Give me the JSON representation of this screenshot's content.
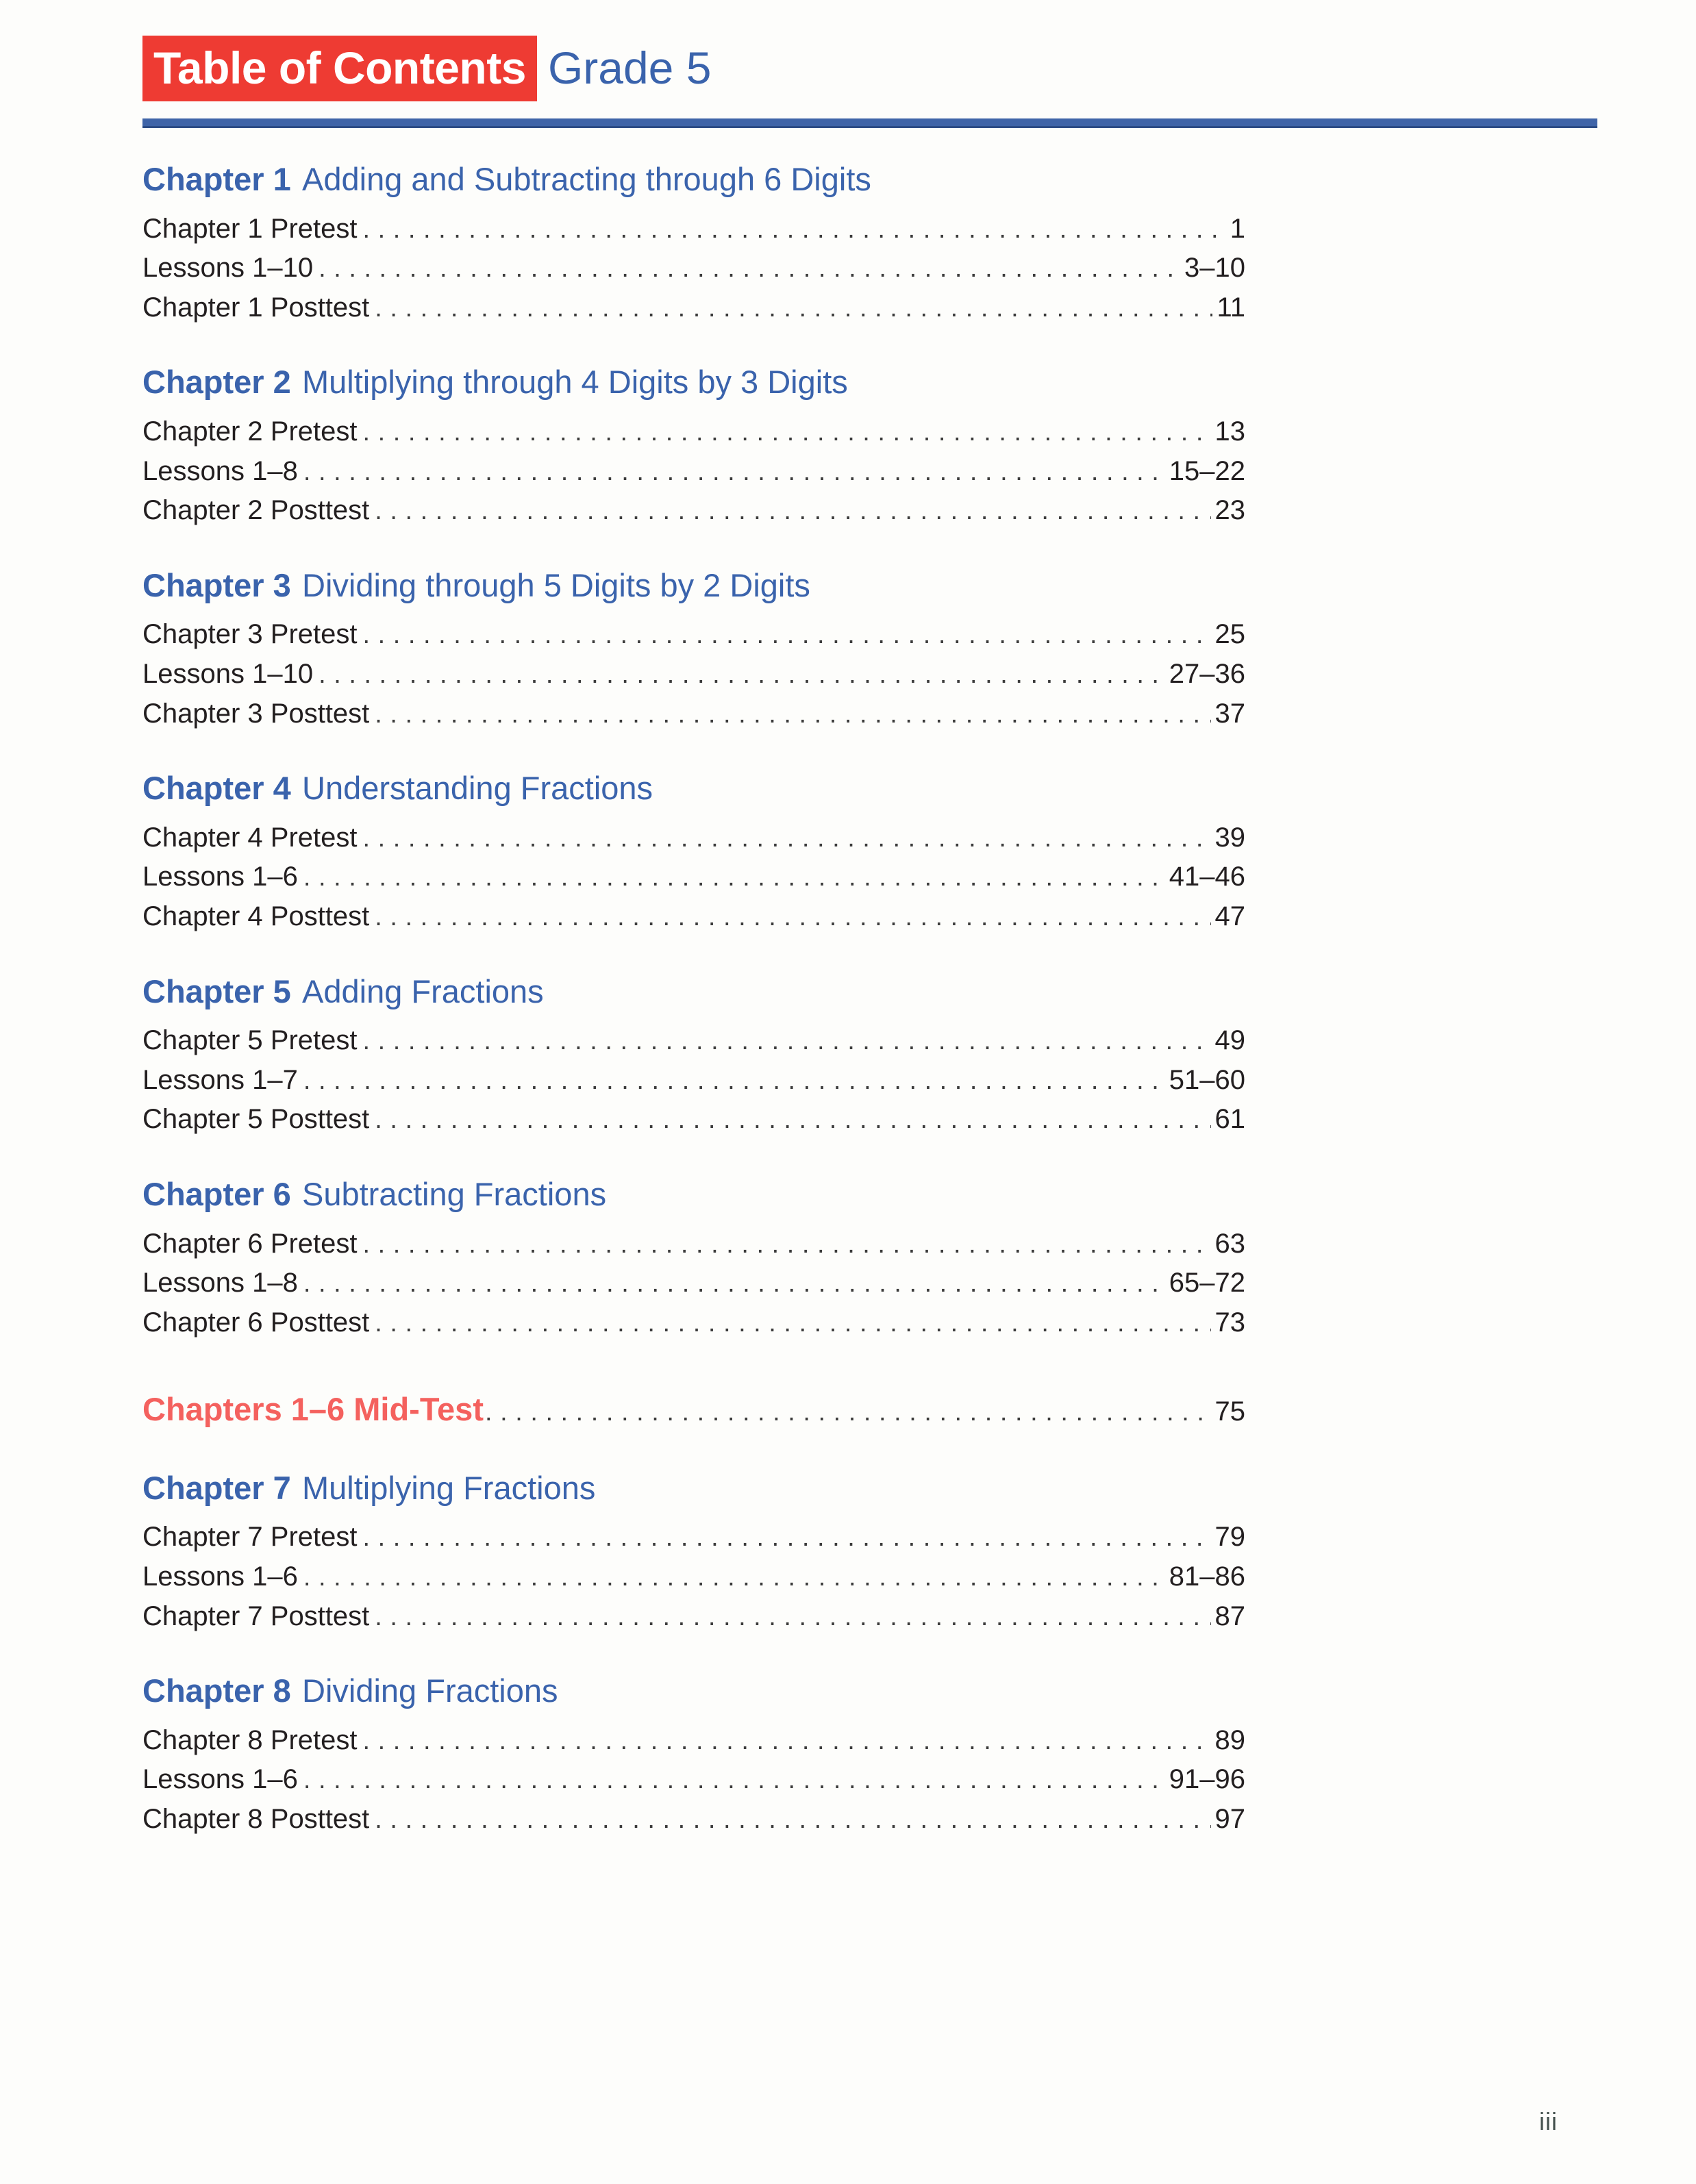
{
  "header": {
    "title": "Table of Contents",
    "grade": "Grade 5",
    "badge_color": "#ee3b33",
    "accent_blue": "#3a63ac",
    "rule_color": "#3f64a8"
  },
  "chapters": [
    {
      "label": "Chapter 1",
      "title": "Adding and Subtracting through 6 Digits",
      "entries": [
        {
          "label": "Chapter 1 Pretest",
          "page": "1"
        },
        {
          "label": "Lessons 1–10",
          "page": "3–10"
        },
        {
          "label": "Chapter 1 Posttest",
          "page": "11"
        }
      ]
    },
    {
      "label": "Chapter 2",
      "title": "Multiplying through 4 Digits by 3 Digits",
      "entries": [
        {
          "label": "Chapter 2 Pretest",
          "page": "13"
        },
        {
          "label": "Lessons 1–8",
          "page": "15–22"
        },
        {
          "label": "Chapter 2 Posttest",
          "page": "23"
        }
      ]
    },
    {
      "label": "Chapter 3",
      "title": "Dividing through 5 Digits by 2 Digits",
      "entries": [
        {
          "label": "Chapter 3 Pretest",
          "page": "25"
        },
        {
          "label": "Lessons 1–10",
          "page": "27–36"
        },
        {
          "label": "Chapter 3 Posttest",
          "page": "37"
        }
      ]
    },
    {
      "label": "Chapter 4",
      "title": "Understanding Fractions",
      "entries": [
        {
          "label": "Chapter 4 Pretest",
          "page": "39"
        },
        {
          "label": "Lessons 1–6",
          "page": "41–46"
        },
        {
          "label": "Chapter 4 Posttest",
          "page": "47"
        }
      ]
    },
    {
      "label": "Chapter 5",
      "title": "Adding Fractions",
      "entries": [
        {
          "label": "Chapter 5 Pretest",
          "page": "49"
        },
        {
          "label": "Lessons 1–7",
          "page": "51–60"
        },
        {
          "label": "Chapter 5 Posttest",
          "page": "61"
        }
      ]
    },
    {
      "label": "Chapter 6",
      "title": "Subtracting Fractions",
      "entries": [
        {
          "label": "Chapter 6 Pretest",
          "page": "63"
        },
        {
          "label": "Lessons 1–8",
          "page": "65–72"
        },
        {
          "label": "Chapter 6 Posttest",
          "page": "73"
        }
      ]
    }
  ],
  "midtest": {
    "label": "Chapters 1–6 Mid-Test",
    "page": "75",
    "color": "#f4615e"
  },
  "chapters_after": [
    {
      "label": "Chapter 7",
      "title": "Multiplying Fractions",
      "entries": [
        {
          "label": "Chapter 7 Pretest",
          "page": "79"
        },
        {
          "label": "Lessons 1–6",
          "page": "81–86"
        },
        {
          "label": "Chapter 7 Posttest",
          "page": "87"
        }
      ]
    },
    {
      "label": "Chapter 8",
      "title": "Dividing Fractions",
      "entries": [
        {
          "label": "Chapter 8 Pretest",
          "page": "89"
        },
        {
          "label": "Lessons 1–6",
          "page": "91–96"
        },
        {
          "label": "Chapter 8 Posttest",
          "page": "97"
        }
      ]
    }
  ],
  "folio": "iii",
  "leader_char": "."
}
